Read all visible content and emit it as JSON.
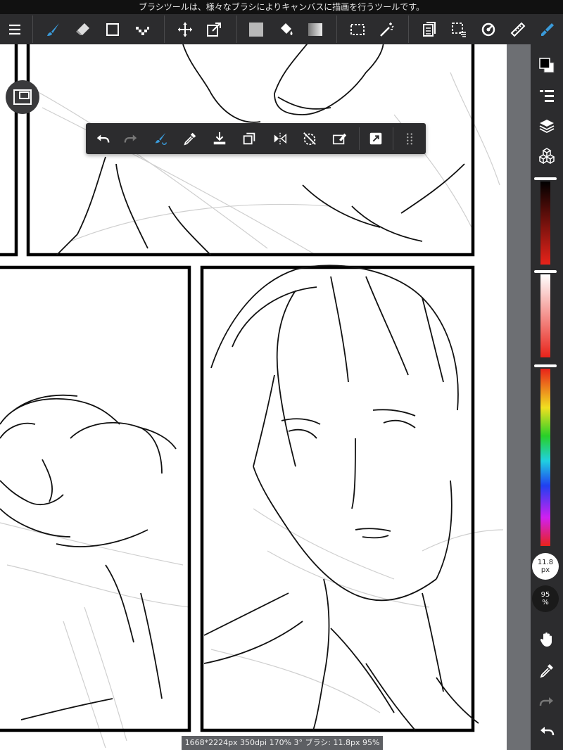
{
  "hint": "ブラシツールは、様々なブラシによりキャンバスに描画を行うツールです。",
  "toolbar": {
    "items": [
      "menu-icon",
      "brush-icon",
      "eraser-icon",
      "rectangle-shape-icon",
      "dot-brush-icon",
      "move-icon",
      "transform-icon",
      "fill-color-icon",
      "bucket-icon",
      "gradient-icon",
      "marquee-selection-icon",
      "magic-wand-icon",
      "pages-icon",
      "select-layer-icon",
      "snap-icon",
      "ruler-icon",
      "pen-settings-icon"
    ],
    "accent": "#3a9ad9"
  },
  "quickbar": {
    "items": [
      "undo-icon",
      "redo-icon",
      "brush-quick-icon",
      "eyedropper-icon",
      "save-icon",
      "copy-icon",
      "flip-icon",
      "rotate-icon",
      "clear-icon",
      "fill-icon",
      "grip-icon"
    ]
  },
  "sidebar": {
    "brush_size": "11.8",
    "brush_size_unit": "px",
    "opacity": "95",
    "opacity_unit": "%",
    "colors": {
      "primary": "#000000",
      "secondary": "#ffffff"
    }
  },
  "status": "1668*2224px 350dpi 170% 3° ブラシ: 11.8px 95%"
}
